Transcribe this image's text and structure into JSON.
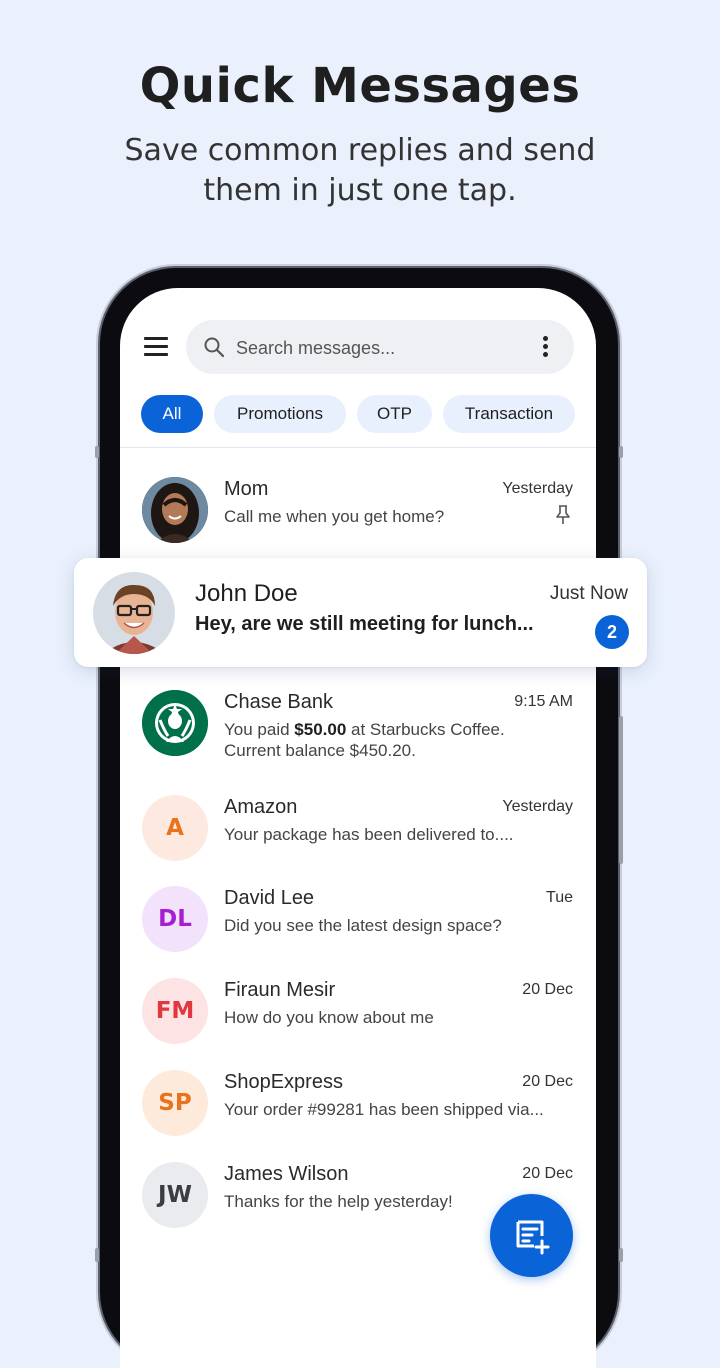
{
  "promo": {
    "title": "Quick Messages",
    "subtitle_line1": "Save common replies and send",
    "subtitle_line2": "them in just one tap."
  },
  "search": {
    "placeholder": "Search messages..."
  },
  "filters": [
    {
      "label": "All",
      "active": true
    },
    {
      "label": "Promotions",
      "active": false
    },
    {
      "label": "OTP",
      "active": false
    },
    {
      "label": "Transaction",
      "active": false
    }
  ],
  "highlighted": {
    "name": "John Doe",
    "time": "Just Now",
    "snippet": "Hey, are we still meeting for lunch...",
    "unread": "2"
  },
  "conversations": [
    {
      "name": "Mom",
      "time": "Yesterday",
      "snippet": "Call me when you get home?",
      "pinned": true,
      "avatar": "photo-woman"
    },
    {
      "name": "Chase Bank",
      "time": "9:15 AM",
      "snippet_pre": "You paid ",
      "snippet_bold": "$50.00",
      "snippet_post": " at Starbucks Coffee.",
      "snippet_line2": "Current balance $450.20.",
      "avatar": "starbucks-logo"
    },
    {
      "name": "Amazon",
      "time": "Yesterday",
      "snippet": "Your package has been delivered to....",
      "initials": "A",
      "bg": "#fde9df",
      "fg": "#e8741f"
    },
    {
      "name": "David Lee",
      "time": "Tue",
      "snippet": "Did you see the latest design space?",
      "initials": "DL",
      "bg": "#f3e2fb",
      "fg": "#a61ed1"
    },
    {
      "name": "Firaun Mesir",
      "time": "20 Dec",
      "snippet": "How do you know about me",
      "initials": "FM",
      "bg": "#fde3e4",
      "fg": "#e0383e"
    },
    {
      "name": "ShopExpress",
      "time": "20 Dec",
      "snippet": "Your order #99281 has been shipped via...",
      "initials": "SP",
      "bg": "#fdeadb",
      "fg": "#e9731c"
    },
    {
      "name": "James Wilson",
      "time": "20 Dec",
      "snippet": "Thanks for the help yesterday!",
      "initials": "JW",
      "bg": "#e9ebee",
      "fg": "#3a3d42"
    }
  ],
  "colors": {
    "accent": "#0b63d8",
    "background": "#eaf1fd"
  },
  "icons": {
    "menu": "menu-icon",
    "search": "search-icon",
    "more": "more-vertical-icon",
    "pin": "pin-icon",
    "compose": "new-message-icon"
  }
}
